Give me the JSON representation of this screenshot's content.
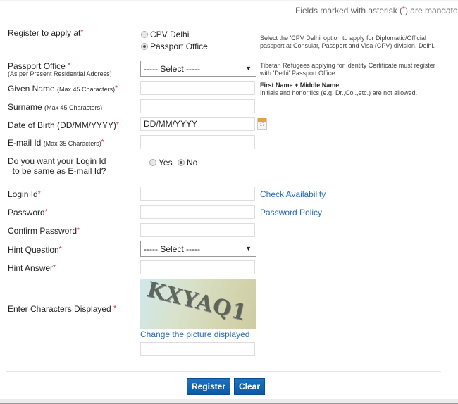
{
  "notice": {
    "text_before": "Fields marked with asterisk (",
    "asterisk": "*",
    "text_after": ") are mandato"
  },
  "register_at": {
    "label": "Register to apply at",
    "asterisk": "*",
    "options": [
      {
        "label": "CPV Delhi",
        "selected": false
      },
      {
        "label": "Passport Office",
        "selected": true
      }
    ],
    "help": "Select the 'CPV Delhi' option to apply for Diplomatic/Official passport at Consular, Passport and Visa (CPV) division, Delhi."
  },
  "passport_office": {
    "label": "Passport Office",
    "asterisk": "*",
    "sublabel": "(As per Present Residential Address)",
    "value": "----- Select -----",
    "help": "Tibetan Refugees applying for Identity Certificate must register with 'Delhi' Passport Office."
  },
  "given_name": {
    "label": "Given Name",
    "hint": "(Max 45 Characters)",
    "asterisk": "*",
    "value": "",
    "help_title": "First Name + Middle Name",
    "help": "Initials and honorifics (e.g. Dr.,Col.,etc.) are not allowed."
  },
  "surname": {
    "label": "Surname",
    "hint": "(Max 45 Characters)",
    "value": ""
  },
  "dob": {
    "label": "Date of Birth (DD/MM/YYYY)",
    "asterisk": "*",
    "value": "DD/MM/YYYY",
    "calendar_day": "17"
  },
  "email": {
    "label": "E-mail Id",
    "hint": "(Max 35 Characters)",
    "asterisk": "*",
    "value": ""
  },
  "login_same": {
    "label_line1": "Do you want your Login Id",
    "label_line2": "to be same as E-mail Id?",
    "options": [
      {
        "label": "Yes",
        "selected": false
      },
      {
        "label": "No",
        "selected": true
      }
    ]
  },
  "login_id": {
    "label": "Login Id",
    "asterisk": "*",
    "value": "",
    "link": "Check Availability"
  },
  "password": {
    "label": "Password",
    "asterisk": "*",
    "value": "",
    "link": "Password Policy"
  },
  "confirm_password": {
    "label": "Confirm Password",
    "asterisk": "*",
    "value": ""
  },
  "hint_question": {
    "label": "Hint Question",
    "asterisk": "*",
    "value": "----- Select -----"
  },
  "hint_answer": {
    "label": "Hint Answer",
    "asterisk": "*",
    "value": ""
  },
  "captcha": {
    "label": "Enter Characters Displayed",
    "asterisk": "*",
    "image_text": "KXYAQ1",
    "change_link": "Change the picture displayed",
    "value": ""
  },
  "buttons": {
    "register": "Register",
    "clear": "Clear"
  }
}
